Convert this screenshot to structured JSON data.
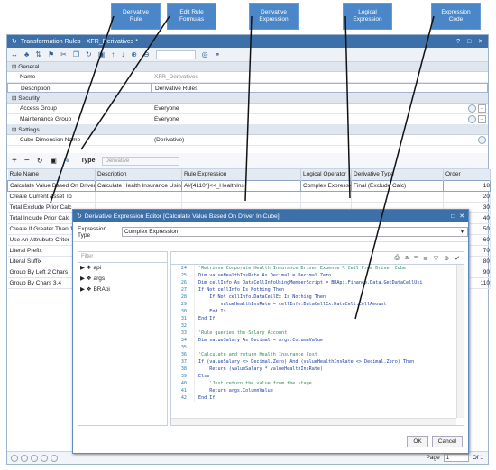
{
  "callouts": [
    "Derivative\nRule",
    "Edit Rule\nFormulas",
    "Derivative\nExpression",
    "Logical\nExpression",
    "Expression\nCode"
  ],
  "window": {
    "title": "Transformation Rules - XFR_Derivatives *",
    "controls": [
      "?",
      "□",
      "✕"
    ]
  },
  "toolbar": {
    "icons": [
      "save",
      "cut",
      "copy",
      "paste",
      "undo",
      "redo",
      "refresh",
      "up",
      "down",
      "zoom-in",
      "zoom-out",
      "search",
      "binoculars"
    ]
  },
  "properties": {
    "general_label": "General",
    "name_key": "Name",
    "name_val": "XFR_Derivatives",
    "desc_key": "Description",
    "desc_val": "Derivative Rules",
    "security_label": "Security",
    "access_key": "Access Group",
    "access_val": "Everyone",
    "maint_key": "Maintenance Group",
    "maint_val": "Everyone",
    "settings_label": "Settings",
    "cube_key": "Cube Dimension Name",
    "cube_val": "(Derivative)"
  },
  "gridtool": {
    "type_label": "Type",
    "type_value": "Derivative"
  },
  "grid": {
    "headers": [
      "Rule Name",
      "Description",
      "Rule Expression",
      "Logical Operator",
      "Derivative Type",
      "Order"
    ],
    "rows": [
      [
        "Calculate Value Based On Driver",
        "Calculate Health Insurance Using",
        "A#[4110*]<<_HealthIns",
        "Complex Expression",
        "Final (Exclude Calc)",
        "18"
      ],
      [
        "Create Current Asset To",
        "",
        "",
        "",
        "",
        "20"
      ],
      [
        "Total Exclude Prior Calc",
        "",
        "",
        "",
        "",
        "30"
      ],
      [
        "Total Include Prior Calc",
        "",
        "",
        "",
        "",
        "40"
      ],
      [
        "Create If Greater Than 1",
        "",
        "",
        "",
        "",
        "50"
      ],
      [
        "Use An Attrubute Criter",
        "",
        "",
        "",
        "",
        "60"
      ],
      [
        "Literal Prefix",
        "",
        "",
        "",
        "",
        "70"
      ],
      [
        "Literal Suffix",
        "",
        "",
        "",
        "",
        "80"
      ],
      [
        "Group By Left 2 Chars",
        "",
        "",
        "",
        "",
        "90"
      ],
      [
        "Group By Chars 3,4",
        "",
        "",
        "",
        "",
        "110"
      ]
    ]
  },
  "pager": {
    "page_label": "Page",
    "page_value": "1",
    "of_label": "Of 1"
  },
  "dialog": {
    "title": "Derivative Expression Editor [Calculate Value Based On Driver In Cube]",
    "etype_label": "Expression Type",
    "etype_value": "Complex Expression",
    "filter_placeholder": "Filter",
    "tree": [
      "api",
      "args",
      "BRApi"
    ],
    "code_lines": [
      [
        "24",
        "'Retrieve Corporate Health Insurance Driver Expense % Cell From Driver Cube"
      ],
      [
        "25",
        "Dim valueHealthInsRate As Decimal = Decimal.Zero"
      ],
      [
        "26",
        "Dim cellInfo As DataCellInfoUsingMemberScript = BRApi.Finance.Data.GetDataCellUsi"
      ],
      [
        "27",
        "If Not cellInfo Is Nothing Then"
      ],
      [
        "28",
        "    If Not cellInfo.DataCellEx Is Nothing Then"
      ],
      [
        "29",
        "        valueHealthInsRate = cellInfo.DataCellEx.DataCell.CellAmount"
      ],
      [
        "30",
        "    End If"
      ],
      [
        "31",
        "End If"
      ],
      [
        "32",
        ""
      ],
      [
        "33",
        "'Rule queries the Salary Account"
      ],
      [
        "34",
        "Dim valueSalary As Decimal = args.ColumnValue"
      ],
      [
        "35",
        ""
      ],
      [
        "36",
        "'Calculate and return Health Insurance Cost"
      ],
      [
        "37",
        "If (valueSalary <> Decimal.Zero) And (valueHealthInsRate <> Decimal.Zero) Then"
      ],
      [
        "38",
        "    Return (valueSalary * valueHealthInsRate)"
      ],
      [
        "39",
        "Else"
      ],
      [
        "40",
        "    'Just return the value from the stage"
      ],
      [
        "41",
        "    Return args.ColumnValue"
      ],
      [
        "42",
        "End If"
      ]
    ],
    "ok": "OK",
    "cancel": "Cancel"
  },
  "colors": {
    "accent": "#3d6fa8",
    "callout": "#4a86c8"
  }
}
